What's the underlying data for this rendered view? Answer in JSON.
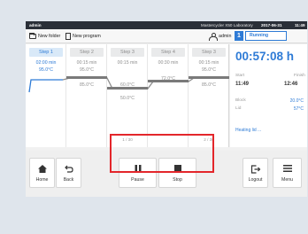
{
  "status_bar": {
    "user": "admin",
    "device": "Mastercycler X50 Laboratory",
    "date": "2017-06-31",
    "time": "11:49"
  },
  "toolbar": {
    "new_folder": "New folder",
    "new_program": "New program",
    "user": "admin",
    "run_number": "1",
    "run_status": "Running"
  },
  "steps": [
    {
      "label": "Step 1",
      "duration": "02:00 min",
      "temperature": "95.0°C",
      "cycle": ""
    },
    {
      "label": "Step 2",
      "duration": "00:15 min",
      "temperature": "95.0°C",
      "temperature2": "85.0°C",
      "cycle": ""
    },
    {
      "label": "Step 3",
      "duration": "00:15 min",
      "temperature": "60.0°C",
      "temperature2": "50.0°C",
      "cycle": "1 / 30"
    },
    {
      "label": "Step 4",
      "duration": "00:30 min",
      "temperature": "72.0°C",
      "cycle": ""
    },
    {
      "label": "Step 3",
      "duration": "00:15 min",
      "temperature": "95.0°C",
      "temperature2": "85.0°C",
      "cycle": "2 / 30"
    }
  ],
  "info": {
    "remaining": "00:57:08 h",
    "start_label": "Start",
    "start": "11:49",
    "finish_label": "Finish",
    "finish": "12:46",
    "block_label": "Block",
    "block": "20.0°C",
    "lid_label": "Lid",
    "lid": "57°C",
    "heating": "Heating lid ..."
  },
  "buttons": {
    "home": "Home",
    "back": "Back",
    "pause": "Pause",
    "stop": "Stop",
    "logout": "Logout",
    "menu": "Menu"
  },
  "colors": {
    "accent": "#2e7bd6",
    "highlight": "#e3262b",
    "topbar": "#2a2f38"
  }
}
